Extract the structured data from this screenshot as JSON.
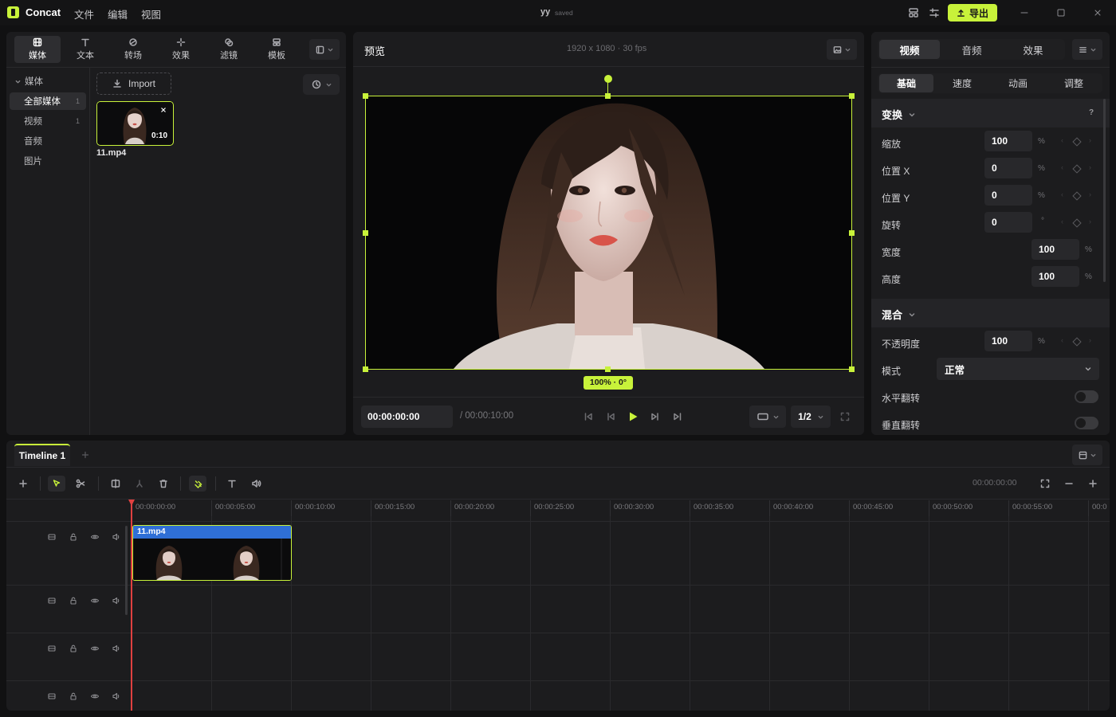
{
  "app": {
    "name": "Concat",
    "menus": [
      "文件",
      "编辑",
      "视图"
    ],
    "project_name": "yy",
    "save_status": "saved",
    "export_label": "导出"
  },
  "left_panel": {
    "tabs": [
      "媒体",
      "文本",
      "转场",
      "效果",
      "滤镜",
      "模板"
    ],
    "section_title": "媒体",
    "categories": [
      {
        "label": "全部媒体",
        "count": "1"
      },
      {
        "label": "视频",
        "count": "1"
      },
      {
        "label": "音频",
        "count": ""
      },
      {
        "label": "图片",
        "count": ""
      }
    ],
    "import_label": "Import",
    "media_items": [
      {
        "name": "11.mp4",
        "duration": "0:10"
      }
    ]
  },
  "preview": {
    "title": "预览",
    "resolution": "1920 x 1080 · 30 fps",
    "transform_badge": "100% · 0°",
    "current_time": "00:00:00:00",
    "total_time": "/ 00:00:10:00",
    "quality": "1/2"
  },
  "properties": {
    "main_tabs": [
      "视频",
      "音频",
      "效果"
    ],
    "sub_tabs": [
      "基础",
      "速度",
      "动画",
      "调整"
    ],
    "transform": {
      "title": "变换",
      "help": "?",
      "rows": [
        {
          "label": "缩放",
          "value": "100",
          "unit": "%"
        },
        {
          "label": "位置 X",
          "value": "0",
          "unit": "%"
        },
        {
          "label": "位置 Y",
          "value": "0",
          "unit": "%"
        },
        {
          "label": "旋转",
          "value": "0",
          "unit": "°"
        },
        {
          "label": "宽度",
          "value": "100",
          "unit": "%"
        },
        {
          "label": "高度",
          "value": "100",
          "unit": "%"
        }
      ]
    },
    "blend": {
      "title": "混合",
      "opacity_label": "不透明度",
      "opacity_value": "100",
      "opacity_unit": "%",
      "mode_label": "模式",
      "mode_value": "正常",
      "hflip_label": "水平翻转",
      "vflip_label": "垂直翻转"
    }
  },
  "timeline": {
    "tab_name": "Timeline 1",
    "time_readout": "00:00:00:00",
    "ruler_labels": [
      "00:00:00:00",
      "00:00:05:00",
      "00:00:10:00",
      "00:00:15:00",
      "00:00:20:00",
      "00:00:25:00",
      "00:00:30:00",
      "00:00:35:00",
      "00:00:40:00",
      "00:00:45:00",
      "00:00:50:00",
      "00:00:55:00",
      "00:0"
    ],
    "clip_name": "11.mp4"
  },
  "colors": {
    "accent": "#c8f23a",
    "clip_header": "#2f6fd6",
    "playhead": "#e04040"
  }
}
